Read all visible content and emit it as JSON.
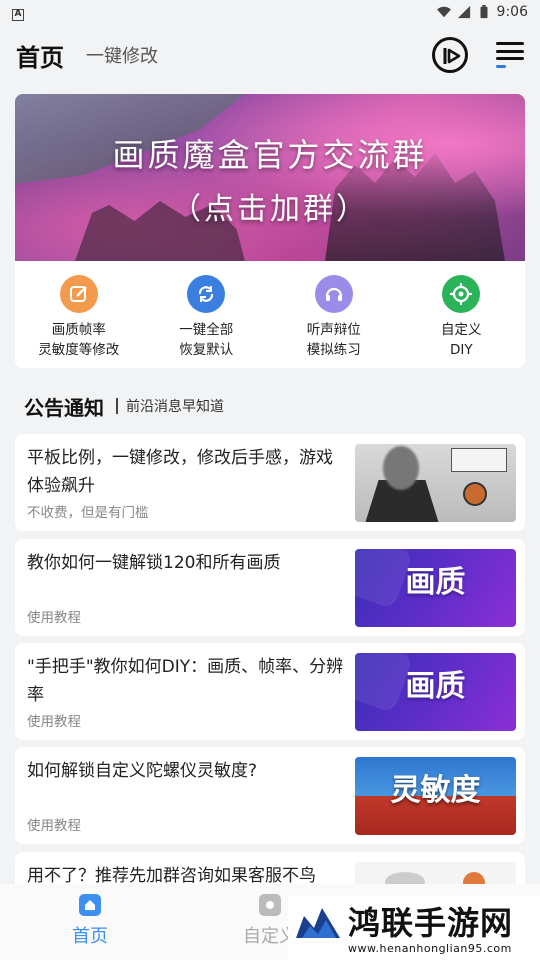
{
  "status_bar": {
    "time": "9:06"
  },
  "header": {
    "title": "首页",
    "subtitle": "一键修改"
  },
  "banner": {
    "title": "画质魔盒官方交流群",
    "subtitle": "（点击加群）"
  },
  "quick_actions": [
    {
      "line1": "画质帧率",
      "line2": "灵敏度等修改",
      "icon": "edit-icon",
      "color": "#f39a4c"
    },
    {
      "line1": "一键全部",
      "line2": "恢复默认",
      "icon": "refresh-icon",
      "color": "#3a7fe0"
    },
    {
      "line1": "听声辩位",
      "line2": "模拟练习",
      "icon": "headset-icon",
      "color": "#9a8ce8"
    },
    {
      "line1": "自定义",
      "line2": "DIY",
      "icon": "crosshair-icon",
      "color": "#2bb35a"
    }
  ],
  "notice": {
    "title": "公告通知",
    "subtitle": "前沿消息早知道"
  },
  "articles": [
    {
      "title": "平板比例，一键修改，修改后手感，游戏体验飙升",
      "meta": "不收费，但是有门槛"
    },
    {
      "title": "教你如何一键解锁120和所有画质",
      "meta": "使用教程",
      "thumb_word": "画质"
    },
    {
      "title": "\"手把手\"教你如何DIY：画质、帧率、分辨率",
      "meta": "使用教程",
      "thumb_word": "画质"
    },
    {
      "title": "如何解锁自定义陀螺仪灵敏度?",
      "meta": "使用教程",
      "thumb_word": "灵敏度"
    },
    {
      "title": "用不了？推荐先加群咨询如果客服不鸟",
      "meta": ""
    }
  ],
  "tabbar": [
    {
      "label": "首页",
      "active": true
    },
    {
      "label": "自定义",
      "active": false
    }
  ],
  "watermark": {
    "name": "鸿联手游网",
    "url": "www.henanhonglian95.com"
  },
  "colors": {
    "accent": "#3d8ff0",
    "page_bg": "#f2f3f5"
  }
}
